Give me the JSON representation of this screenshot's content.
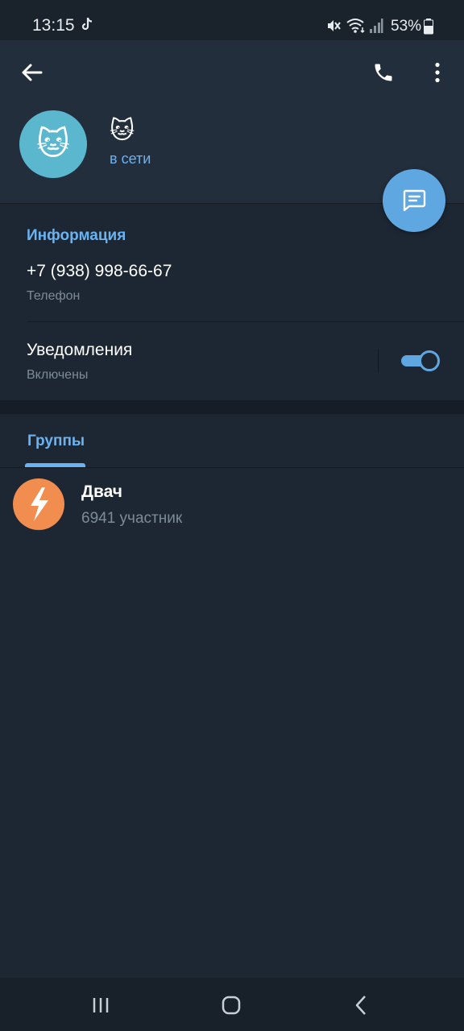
{
  "status_bar": {
    "time": "13:15",
    "battery_percent": "53%",
    "icons": [
      "tiktok-icon",
      "mute-icon",
      "wifi-icon",
      "signal-icon",
      "battery-icon"
    ]
  },
  "header": {
    "name": "🐱",
    "avatar_emoji": "🐱",
    "status": "в сети",
    "icons": [
      "back-arrow-icon",
      "phone-icon",
      "more-vertical-icon"
    ]
  },
  "fab": {
    "icon": "message-icon"
  },
  "info": {
    "title": "Информация",
    "phone": "+7 (938) 998-66-67",
    "phone_caption": "Телефон",
    "notifications_label": "Уведомления",
    "notifications_caption": "Включены",
    "notifications_enabled": true
  },
  "tabs": [
    {
      "label": "Группы",
      "active": true
    }
  ],
  "groups": [
    {
      "name": "Двач",
      "members": "6941 участник",
      "avatar_color": "#f08d4f",
      "avatar_icon": "lightning-icon"
    }
  ],
  "nav": {
    "icons": [
      "recents-icon",
      "home-icon",
      "back-icon"
    ]
  },
  "colors": {
    "accent": "#6ab3f3",
    "header_bg": "#232e3c",
    "background": "#1d2733",
    "fab": "#5fa7e0",
    "secondary_text": "#7d8b99"
  }
}
